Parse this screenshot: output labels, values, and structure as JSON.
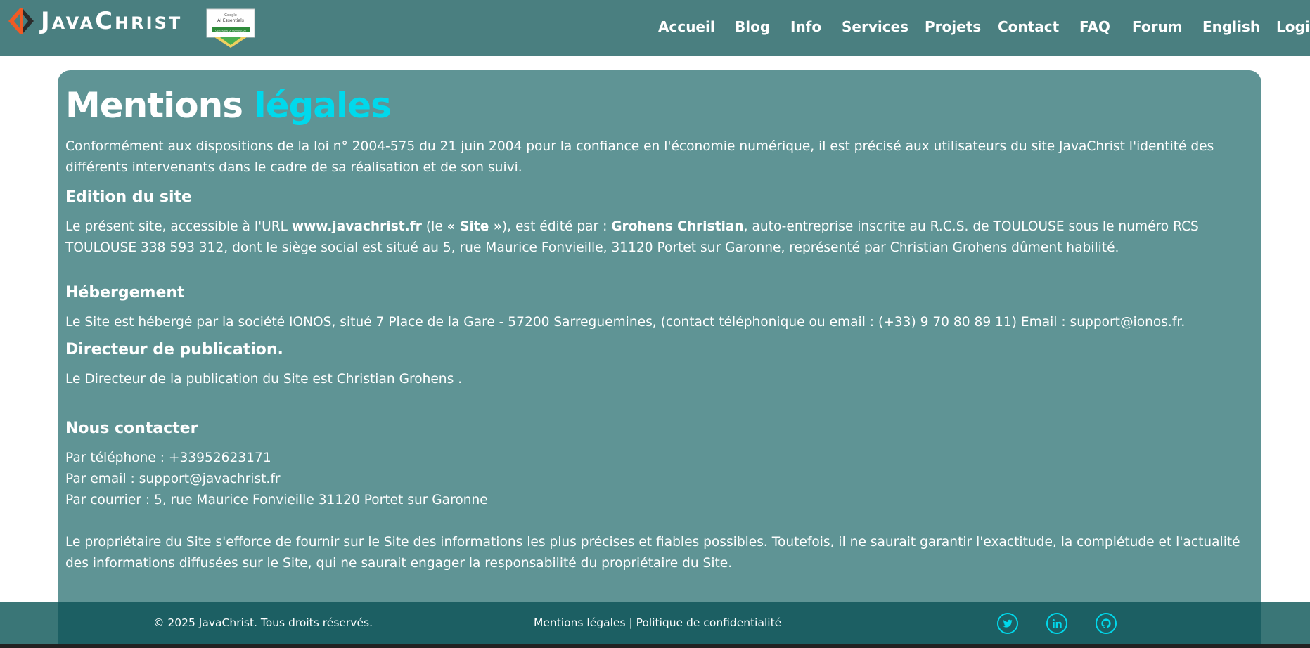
{
  "header": {
    "logo_text": "JavaChrist",
    "badge_lines": [
      "Google",
      "AI Essentials",
      "Certificate of Completion"
    ],
    "nav": [
      "Accueil",
      "Blog",
      "Info",
      "Services",
      "Projets",
      "Contact",
      "FAQ",
      "Forum",
      "English",
      "Login"
    ]
  },
  "content": {
    "title_main": "Mentions",
    "title_accent": "légales",
    "intro": "Conformément aux dispositions de la loi n° 2004-575 du 21 juin 2004 pour la confiance en l'économie numérique, il est précisé aux utilisateurs du site JavaChrist l'identité des différents intervenants dans le cadre de sa réalisation et de son suivi.",
    "edition": {
      "heading": "Edition du site",
      "p1": "Le présent site, accessible à l'URL ",
      "url": "www.javachrist.fr",
      "p2": " (le ",
      "site": "« Site »",
      "p3": "), est édité par : ",
      "owner": "Grohens Christian",
      "p4": ", auto-entreprise inscrite au R.C.S. de TOULOUSE sous le numéro RCS TOULOUSE 338 593 312, dont le siège social est situé au 5, rue Maurice Fonvieille, 31120 Portet sur Garonne, représenté par Christian Grohens dûment habilité."
    },
    "hosting": {
      "heading": "Hébergement",
      "text": "Le Site est hébergé par la société IONOS, situé 7 Place de la Gare - 57200 Sarreguemines, (contact téléphonique ou email : (+33) 9 70 80 89 11) Email : support@ionos.fr."
    },
    "director": {
      "heading": "Directeur de publication.",
      "text": "Le Directeur de la publication du Site est Christian Grohens ."
    },
    "contact": {
      "heading": "Nous contacter",
      "phone": "Par téléphone : +33952623171",
      "email": "Par email : support@javachrist.fr",
      "mail": "Par courrier : 5, rue Maurice Fonvieille 31120 Portet sur Garonne"
    },
    "disclaimer": "Le propriétaire du Site s'efforce de fournir sur le Site des informations les plus précises et fiables possibles. Toutefois, il ne saurait garantir l'exactitude, la complétude et l'actualité des informations diffusées sur le Site, qui ne saurait engager la responsabilité du propriétaire du Site."
  },
  "footer": {
    "copyright": "© 2025 JavaChrist. Tous droits réservés.",
    "link_legal": "Mentions légales",
    "separator": " | ",
    "link_privacy": "Politique de confidentialité",
    "social": [
      "twitter-icon",
      "linkedin-icon",
      "github-icon"
    ]
  },
  "colors": {
    "header_bg": "#4a7f80",
    "card_bg": "#5f9495",
    "accent": "#00d9ec",
    "footer_bg": "#1c5f63"
  }
}
